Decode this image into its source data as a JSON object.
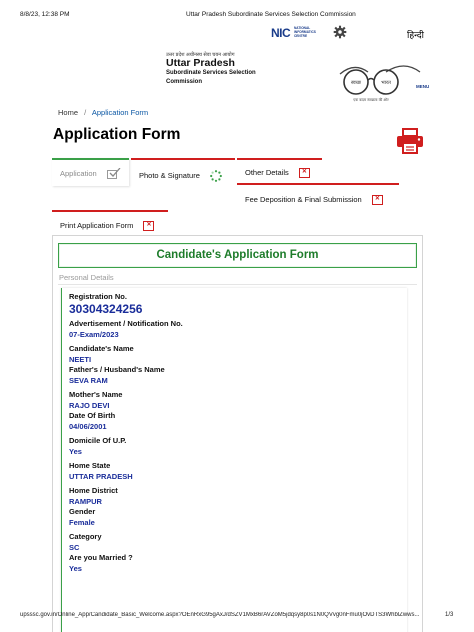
{
  "print": {
    "date": "8/8/23, 12:38 PM",
    "title": "Uttar Pradesh Subordinate Services Selection Commission",
    "url": "upsssc.gov.in/Online_App/Candidate_Basic_Welcome.aspx?OEnRxG95gAxJ/dSZV1MxB6rAVZoM5jdqsy8p0s1N0QVvg0nFmu0jOvDTS3WhblZwws...",
    "page": "1/3"
  },
  "header": {
    "nic_logo": "NIC",
    "nic_sub": [
      "NATIONAL",
      "INFORMATICS",
      "CENTRE"
    ],
    "language_link": "हिन्दी",
    "org_hindi": "उत्तर प्रदेश अधीनस्थ सेवा चयन आयोग",
    "org_name": "Uttar Pradesh",
    "org_sub": "Subordinate Services Selection Commission",
    "emblem_text_left": "स्वच्छ",
    "emblem_text_right": "भारत",
    "emblem_tagline": "एक कदम स्वच्छता की ओर",
    "menu_label": "MENU"
  },
  "breadcrumb": {
    "home": "Home",
    "separator": "/",
    "current": "Application Form"
  },
  "page_title": "Application Form",
  "tabs": {
    "application": "Application",
    "photo": "Photo & Signature",
    "other": "Other Details",
    "fee": "Fee Deposition & Final Submission",
    "print": "Print Application Form"
  },
  "form": {
    "title": "Candidate's Application Form",
    "section": "Personal Details",
    "fields": [
      {
        "label": "Registration No.",
        "value": "30304324256"
      },
      {
        "label": "Advertisement / Notification No.",
        "value": "07-Exam/2023"
      },
      {
        "label": "Candidate's Name",
        "value": "NEETI"
      },
      {
        "label": "Father's / Husband's Name",
        "value": "SEVA RAM"
      },
      {
        "label": "Mother's Name",
        "value": "RAJO DEVI"
      },
      {
        "label": "Date Of Birth",
        "value": "04/06/2001"
      },
      {
        "label": "Domicile Of U.P.",
        "value": "Yes"
      },
      {
        "label": "Home State",
        "value": "UTTAR PRADESH"
      },
      {
        "label": "Home District",
        "value": "RAMPUR"
      },
      {
        "label": "Gender",
        "value": "Female"
      },
      {
        "label": "Category",
        "value": "SC"
      },
      {
        "label": "Are you Married ?",
        "value": "Yes"
      }
    ]
  },
  "colors": {
    "green": "#3aa048",
    "red": "#d01e1e",
    "blue_value": "#1a2d9a"
  },
  "icons": [
    "nic-logo",
    "gear-icon",
    "swachh-bharat-emblem",
    "printer-icon",
    "checkbox-icon",
    "spinner-icon",
    "close-x-icon"
  ]
}
